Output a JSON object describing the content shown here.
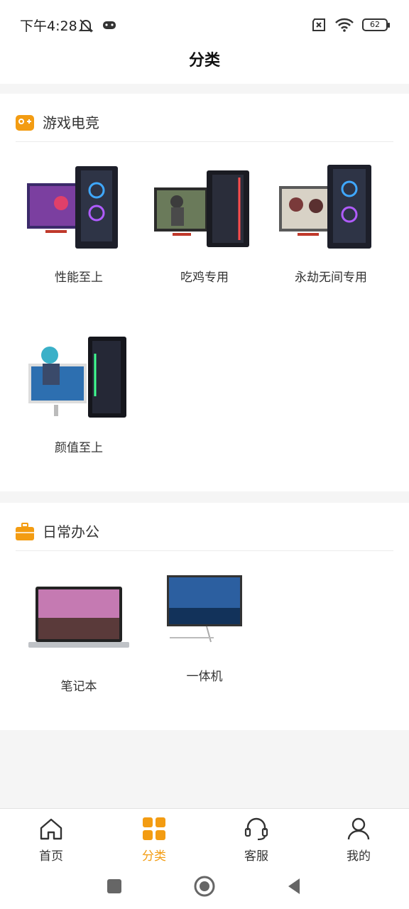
{
  "status": {
    "time": "下午4:28",
    "battery": "62",
    "icons": [
      "bell-muted-icon",
      "gamepad-icon",
      "no-sim-icon",
      "wifi-icon",
      "battery-icon"
    ]
  },
  "header": {
    "title": "分类"
  },
  "sections": [
    {
      "title": "游戏电竞",
      "icon": "gamepad-badge-icon",
      "items": [
        {
          "label": "性能至上",
          "image": "gaming-pc-image"
        },
        {
          "label": "吃鸡专用",
          "image": "gaming-pc-image"
        },
        {
          "label": "永劫无间专用",
          "image": "gaming-pc-image"
        },
        {
          "label": "颜值至上",
          "image": "gaming-pc-image"
        }
      ]
    },
    {
      "title": "日常办公",
      "icon": "briefcase-icon",
      "items": [
        {
          "label": "笔记本",
          "image": "laptop-image"
        },
        {
          "label": "一体机",
          "image": "all-in-one-image"
        }
      ]
    }
  ],
  "nav": {
    "items": [
      {
        "label": "首页",
        "icon": "home-icon",
        "active": false
      },
      {
        "label": "分类",
        "icon": "category-icon",
        "active": true
      },
      {
        "label": "客服",
        "icon": "headset-icon",
        "active": false
      },
      {
        "label": "我的",
        "icon": "user-icon",
        "active": false
      }
    ]
  },
  "colors": {
    "accent": "#f39c12",
    "background": "#f5f5f5",
    "card": "#ffffff"
  }
}
